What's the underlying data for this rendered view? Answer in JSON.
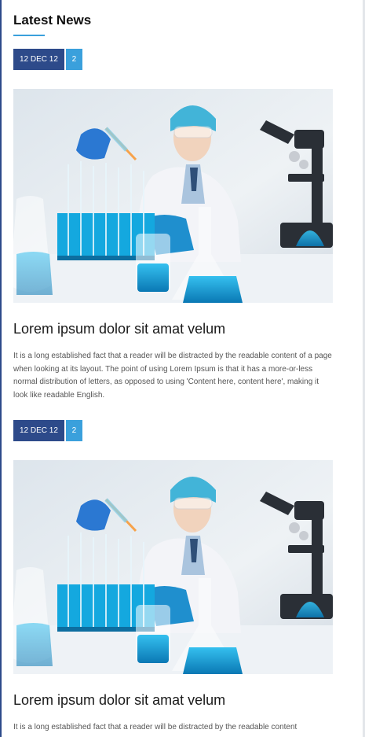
{
  "section": {
    "title": "Latest News"
  },
  "posts": [
    {
      "date": "12 DEC 12",
      "count": "2",
      "image": "scientist-lab-photo",
      "title": "Lorem ipsum dolor sit amat velum",
      "excerpt": "It is a long established fact that a reader will be distracted by the readable content of a page when looking at its layout. The point of using Lorem Ipsum is that it has a more-or-less normal distribution of letters, as opposed to using 'Content here, content here', making it look like readable English."
    },
    {
      "date": "12 DEC 12",
      "count": "2",
      "image": "scientist-lab-photo",
      "title": "Lorem ipsum dolor sit amat velum",
      "excerpt": "It is a long established fact that a reader will be distracted by the readable content"
    }
  ],
  "colors": {
    "primary": "#2d4a8a",
    "accent": "#3aa0dc"
  }
}
